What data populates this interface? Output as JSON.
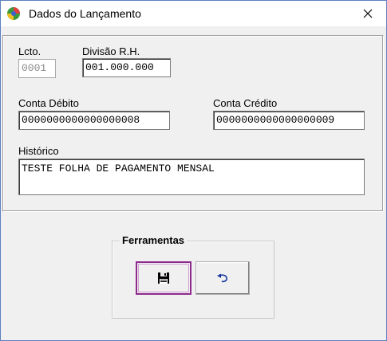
{
  "window": {
    "title": "Dados do Lançamento",
    "icon": "app-globe-icon",
    "close_icon": "close-icon"
  },
  "form": {
    "lcto": {
      "label": "Lcto.",
      "value": "0001"
    },
    "divisao": {
      "label": "Divisão R.H.",
      "value": "001.000.000"
    },
    "conta_debito": {
      "label": "Conta Débito",
      "value": "0000000000000000008"
    },
    "conta_credito": {
      "label": "Conta Crédito",
      "value": "0000000000000000009"
    },
    "historico": {
      "label": "Histórico",
      "value": "TESTE FOLHA DE PAGAMENTO MENSAL"
    }
  },
  "toolbar": {
    "title": "Ferramentas",
    "save_icon": "floppy-disk-icon",
    "undo_icon": "undo-arrow-icon"
  }
}
